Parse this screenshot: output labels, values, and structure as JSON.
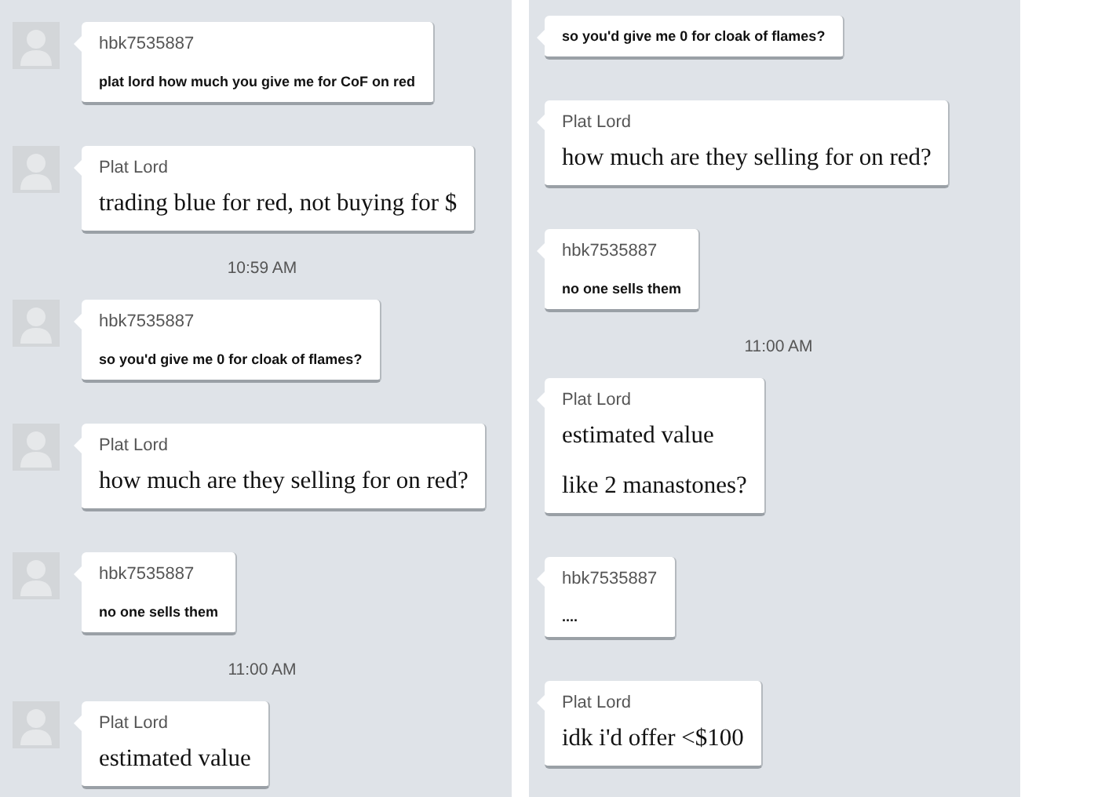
{
  "panels": [
    {
      "items": [
        {
          "kind": "small",
          "sender": "hbk7535887",
          "lines": [
            "plat lord how much you give me for CoF on red"
          ]
        },
        {
          "kind": "large",
          "sender": "Plat Lord",
          "lines": [
            "trading blue for red, not buying for $"
          ]
        },
        {
          "kind": "timestamp",
          "text": "10:59 AM"
        },
        {
          "kind": "small",
          "sender": "hbk7535887",
          "lines": [
            "so you'd give me 0 for cloak of flames?"
          ]
        },
        {
          "kind": "large",
          "sender": "Plat Lord",
          "lines": [
            "how much are they selling for on red?"
          ]
        },
        {
          "kind": "small",
          "sender": "hbk7535887",
          "lines": [
            "no one sells them"
          ]
        },
        {
          "kind": "timestamp",
          "text": "11:00 AM"
        },
        {
          "kind": "large",
          "sender": "Plat Lord",
          "lines": [
            "estimated value"
          ]
        }
      ]
    },
    {
      "items": [
        {
          "kind": "small",
          "lines": [
            "so you'd give me 0 for cloak of flames?"
          ]
        },
        {
          "kind": "large",
          "sender": "Plat Lord",
          "lines": [
            "how much are they selling for on red?"
          ]
        },
        {
          "kind": "small",
          "sender": "hbk7535887",
          "lines": [
            "no one sells them"
          ]
        },
        {
          "kind": "timestamp",
          "text": "11:00 AM"
        },
        {
          "kind": "large",
          "sender": "Plat Lord",
          "lines": [
            "estimated value",
            "like 2 manastones?"
          ]
        },
        {
          "kind": "small",
          "sender": "hbk7535887",
          "lines": [
            "...."
          ]
        },
        {
          "kind": "large",
          "sender": "Plat Lord",
          "lines": [
            "idk i'd offer <$100"
          ]
        }
      ]
    }
  ]
}
